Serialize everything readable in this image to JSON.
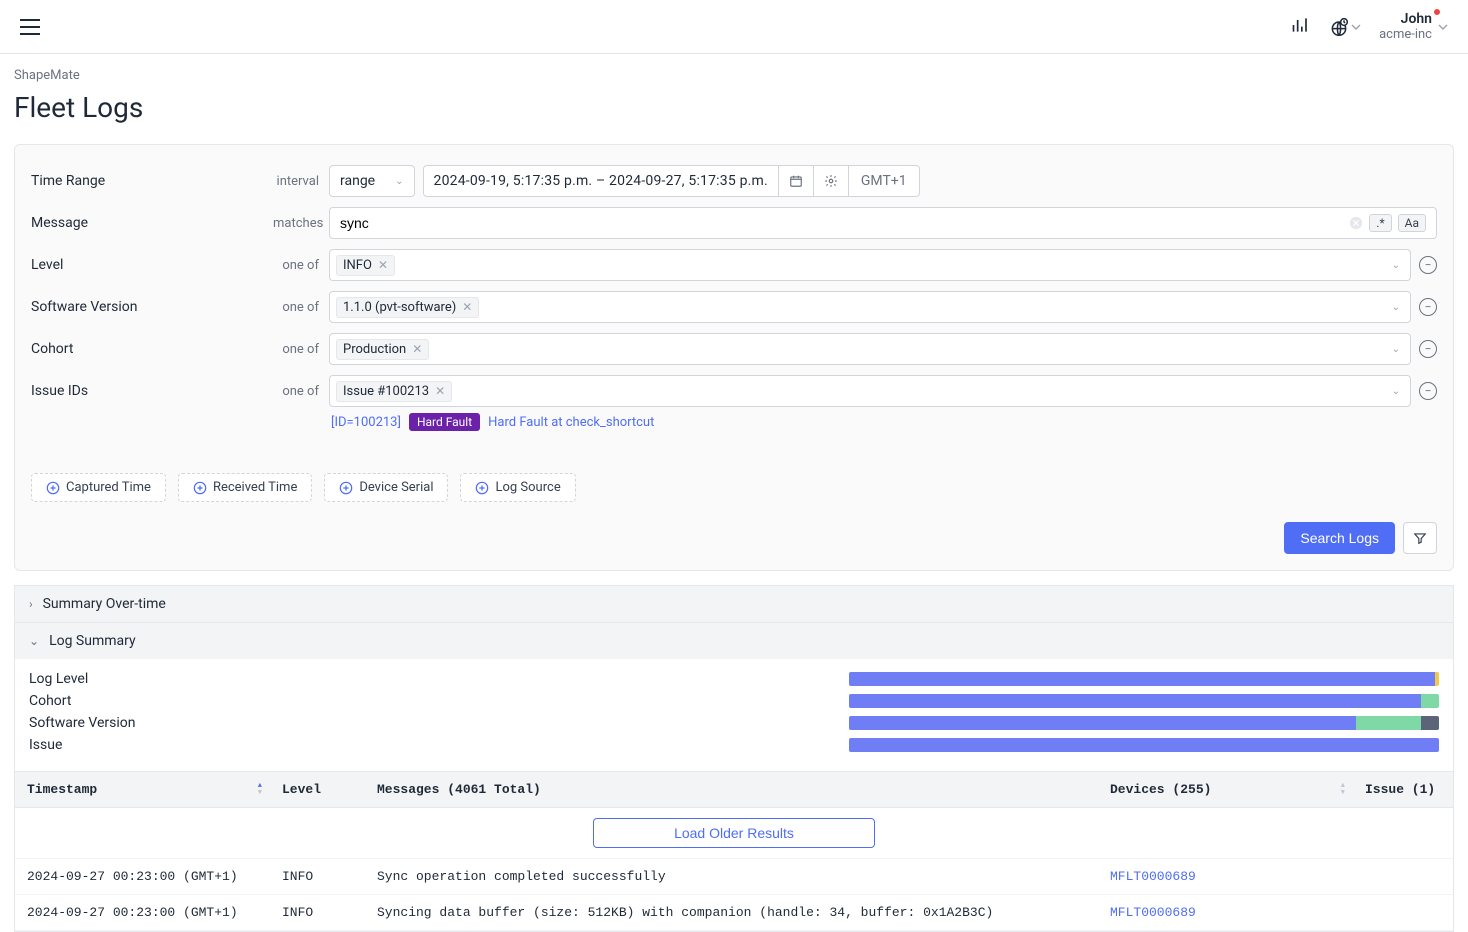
{
  "header": {
    "user_name": "John",
    "user_org": "acme-inc"
  },
  "breadcrumb": "ShapeMate",
  "page_title": "Fleet Logs",
  "filters": {
    "time_range": {
      "label": "Time Range",
      "sublabel": "interval",
      "select_value": "range",
      "date_text": "2024-09-19, 5:17:35 p.m. – 2024-09-27, 5:17:35 p.m.",
      "tz": "GMT+1"
    },
    "message": {
      "label": "Message",
      "sublabel": "matches",
      "value": "sync",
      "regex_label": ".*",
      "case_label": "Aa"
    },
    "level": {
      "label": "Level",
      "sublabel": "one of",
      "tags": [
        "INFO"
      ]
    },
    "software_version": {
      "label": "Software Version",
      "sublabel": "one of",
      "tags": [
        "1.1.0 (pvt-software)"
      ]
    },
    "cohort": {
      "label": "Cohort",
      "sublabel": "one of",
      "tags": [
        "Production"
      ]
    },
    "issue_ids": {
      "label": "Issue IDs",
      "sublabel": "one of",
      "tags": [
        "Issue #100213"
      ],
      "issue_id": "[ID=100213]",
      "badge": "Hard Fault",
      "issue_title": "Hard Fault at check_shortcut"
    }
  },
  "add_filters": [
    "Captured Time",
    "Received Time",
    "Device Serial",
    "Log Source"
  ],
  "search_button": "Search Logs",
  "sections": {
    "summary_over_time": "Summary Over-time",
    "log_summary": "Log Summary"
  },
  "summary_rows": {
    "log_level": {
      "label": "Log Level",
      "segments": [
        {
          "color": "#6f7ef5",
          "pct": 99.4
        },
        {
          "color": "#f2c94c",
          "pct": 0.6
        }
      ]
    },
    "cohort": {
      "label": "Cohort",
      "segments": [
        {
          "color": "#6f7ef5",
          "pct": 97
        },
        {
          "color": "#7fd9a6",
          "pct": 3
        }
      ]
    },
    "software_version": {
      "label": "Software Version",
      "segments": [
        {
          "color": "#6f7ef5",
          "pct": 86
        },
        {
          "color": "#7fd9a6",
          "pct": 11
        },
        {
          "color": "#5b6478",
          "pct": 3
        }
      ]
    },
    "issue": {
      "label": "Issue",
      "segments": [
        {
          "color": "#6f7ef5",
          "pct": 100
        }
      ]
    }
  },
  "table": {
    "headers": {
      "timestamp": "Timestamp",
      "level": "Level",
      "messages": "Messages (4061 Total)",
      "devices": "Devices (255)",
      "issue": "Issue (1)"
    },
    "load_older": "Load Older Results",
    "rows": [
      {
        "ts": "2024-09-27 00:23:00 (GMT+1)",
        "level": "INFO",
        "msg": "Sync operation completed successfully",
        "device": "MFLT0000689",
        "issue": ""
      },
      {
        "ts": "2024-09-27 00:23:00 (GMT+1)",
        "level": "INFO",
        "msg": "Syncing data buffer (size: 512KB) with companion (handle: 34, buffer: 0x1A2B3C)",
        "device": "MFLT0000689",
        "issue": ""
      }
    ]
  }
}
